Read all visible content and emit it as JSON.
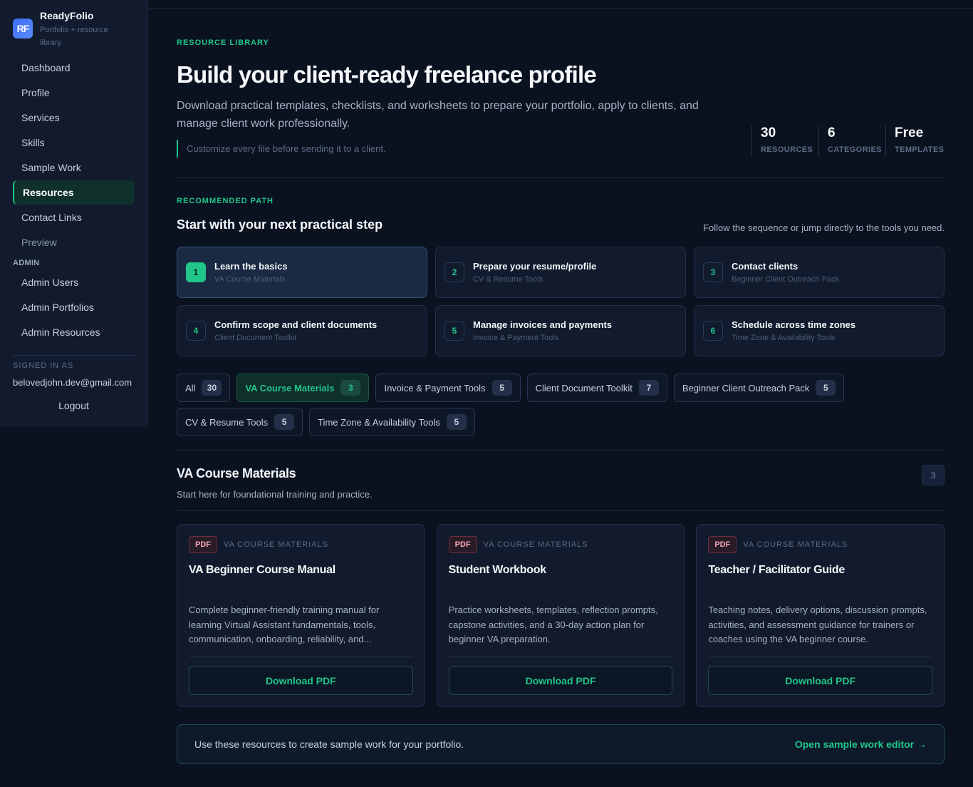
{
  "sidebar": {
    "brand": {
      "logo_text": "RF",
      "name": "ReadyFolio",
      "subtitle": "Portfolio + resource library"
    },
    "nav": [
      {
        "label": "Dashboard"
      },
      {
        "label": "Profile"
      },
      {
        "label": "Services"
      },
      {
        "label": "Skills"
      },
      {
        "label": "Sample Work"
      },
      {
        "label": "Resources"
      },
      {
        "label": "Contact Links"
      },
      {
        "label": "Preview"
      }
    ],
    "admin_heading": "ADMIN",
    "admin_nav": [
      {
        "label": "Admin Users"
      },
      {
        "label": "Admin Portfolios"
      },
      {
        "label": "Admin Resources"
      }
    ],
    "signed_in_label": "SIGNED IN AS",
    "signed_in_email": "belovedjohn.dev@gmail.com",
    "logout_label": "Logout"
  },
  "hero": {
    "eyebrow": "RESOURCE LIBRARY",
    "title": "Build your client-ready freelance profile",
    "description": "Download practical templates, checklists, and worksheets to prepare your portfolio, apply to clients, and manage client work professionally.",
    "note": "Customize every file before sending it to a client.",
    "stats": [
      {
        "value": "30",
        "label": "RESOURCES"
      },
      {
        "value": "6",
        "label": "CATEGORIES"
      },
      {
        "value": "Free",
        "label": "TEMPLATES"
      }
    ]
  },
  "recommended": {
    "eyebrow": "RECOMMENDED PATH",
    "title": "Start with your next practical step",
    "hint": "Follow the sequence or jump directly to the tools you need.",
    "steps": [
      {
        "num": "1",
        "title": "Learn the basics",
        "sub": "VA Course Materials"
      },
      {
        "num": "2",
        "title": "Prepare your resume/profile",
        "sub": "CV & Resume Tools"
      },
      {
        "num": "3",
        "title": "Contact clients",
        "sub": "Beginner Client Outreach Pack"
      },
      {
        "num": "4",
        "title": "Confirm scope and client documents",
        "sub": "Client Document Toolkit"
      },
      {
        "num": "5",
        "title": "Manage invoices and payments",
        "sub": "Invoice & Payment Tools"
      },
      {
        "num": "6",
        "title": "Schedule across time zones",
        "sub": "Time Zone & Availability Tools"
      }
    ]
  },
  "filters": [
    {
      "label": "All",
      "count": "30"
    },
    {
      "label": "VA Course Materials",
      "count": "3"
    },
    {
      "label": "Invoice & Payment Tools",
      "count": "5"
    },
    {
      "label": "Client Document Toolkit",
      "count": "7"
    },
    {
      "label": "Beginner Client Outreach Pack",
      "count": "5"
    },
    {
      "label": "CV & Resume Tools",
      "count": "5"
    },
    {
      "label": "Time Zone & Availability Tools",
      "count": "5"
    }
  ],
  "section": {
    "title": "VA Course Materials",
    "subtitle": "Start here for foundational training and practice.",
    "count": "3"
  },
  "cards": [
    {
      "type": "PDF",
      "category": "VA COURSE MATERIALS",
      "title": "VA Beginner Course Manual",
      "description": "Complete beginner-friendly training manual for learning Virtual Assistant fundamentals, tools, communication, onboarding, reliability, and...",
      "button": "Download PDF"
    },
    {
      "type": "PDF",
      "category": "VA COURSE MATERIALS",
      "title": "Student Workbook",
      "description": "Practice worksheets, templates, reflection prompts, capstone activities, and a 30-day action plan for beginner VA preparation.",
      "button": "Download PDF"
    },
    {
      "type": "PDF",
      "category": "VA COURSE MATERIALS",
      "title": "Teacher / Facilitator Guide",
      "description": "Teaching notes, delivery options, discussion prompts, activities, and assessment guidance for trainers or coaches using the VA beginner course.",
      "button": "Download PDF"
    }
  ],
  "footer": {
    "text": "Use these resources to create sample work for your portfolio.",
    "link": "Open sample work editor →"
  },
  "colors": {
    "accent": "#20c58a",
    "background": "#0a1220",
    "sidebar": "#111b2d"
  }
}
